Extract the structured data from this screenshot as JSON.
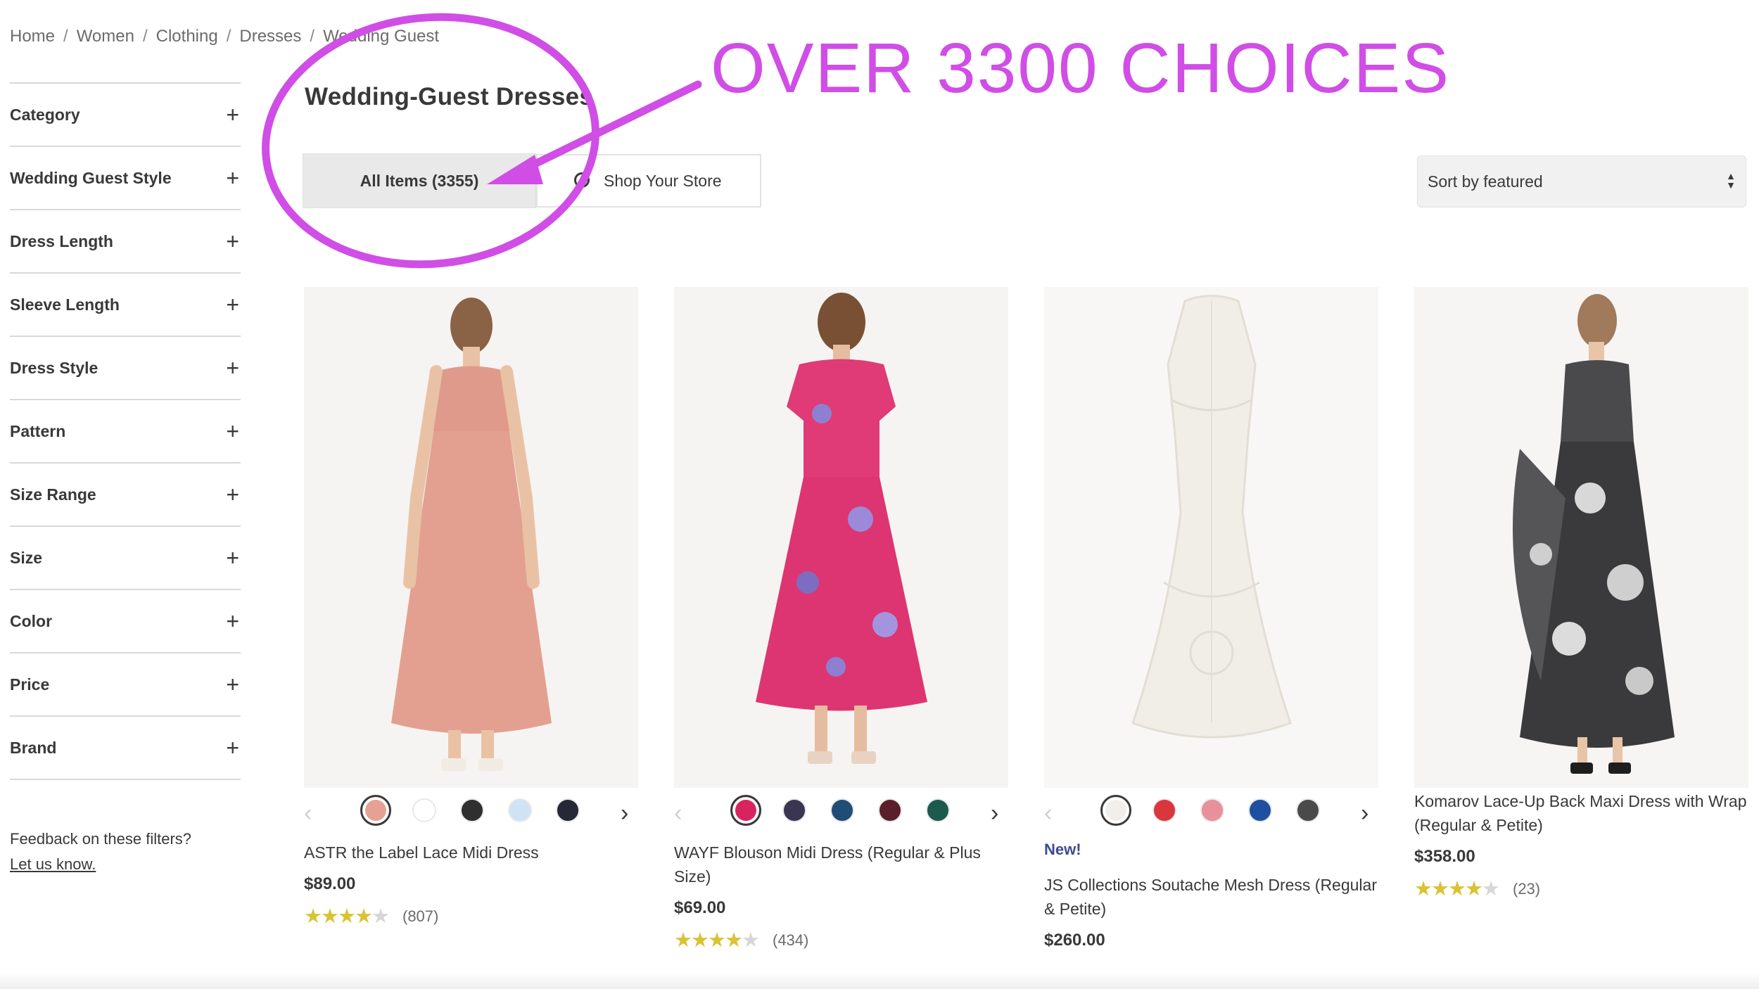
{
  "breadcrumb": [
    "Home",
    "Women",
    "Clothing",
    "Dresses",
    "Wedding Guest"
  ],
  "sidebar": {
    "filters": [
      "Category",
      "Wedding Guest Style",
      "Dress Length",
      "Sleeve Length",
      "Dress Style",
      "Pattern",
      "Size Range",
      "Size",
      "Color",
      "Price",
      "Brand"
    ],
    "feedback_text": "Feedback on these filters?",
    "feedback_link": "Let us know."
  },
  "header": {
    "title": "Wedding-Guest Dresses",
    "tab_all": "All Items (3355)",
    "tab_store": "Shop Your Store",
    "sort_label": "Sort by featured"
  },
  "annotation": {
    "text": "OVER 3300 CHOICES",
    "color": "#d04ee6"
  },
  "products": [
    {
      "name": "ASTR the Label Lace Midi Dress",
      "price": "$89.00",
      "reviews": "(807)",
      "rating": 4.5,
      "is_new": false,
      "dress_color": "#e3a091",
      "swatches": [
        "#e7a194",
        "#ffffff",
        "#2f2f2f",
        "#cfe3f4",
        "#262838"
      ]
    },
    {
      "name": "WAYF Blouson Midi Dress (Regular & Plus Size)",
      "price": "$69.00",
      "reviews": "(434)",
      "rating": 4,
      "is_new": false,
      "dress_color": "#e03a77",
      "swatches": [
        "#d8245e",
        "#3a3550",
        "#1f4d75",
        "#5a1f2a",
        "#1c5a4e"
      ]
    },
    {
      "new_label": "New!",
      "name": "JS Collections Soutache Mesh Dress (Regular & Petite)",
      "price": "$260.00",
      "reviews": "",
      "rating": 0,
      "is_new": true,
      "dress_color": "#f3f0ea",
      "swatches": [
        "#f2efea",
        "#d9363e",
        "#e8909c",
        "#1f4fa0",
        "#4a4a4a"
      ]
    },
    {
      "name": "Komarov Lace-Up Back Maxi Dress with Wrap (Regular & Petite)",
      "price": "$358.00",
      "reviews": "(23)",
      "rating": 4.5,
      "is_new": false,
      "dress_color": "#3a3a3c",
      "swatches": []
    }
  ]
}
